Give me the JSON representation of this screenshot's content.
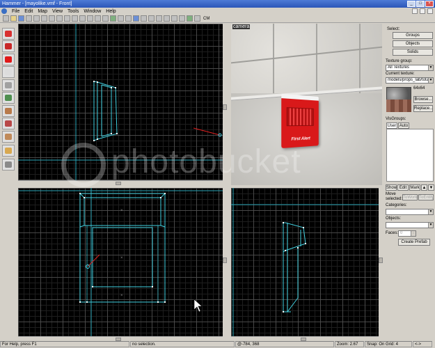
{
  "window": {
    "title": "Hammer - [mayolike.vmf - Front]",
    "controls": [
      "_",
      "□",
      "×"
    ]
  },
  "menu": {
    "items": [
      "File",
      "Edit",
      "Map",
      "View",
      "Tools",
      "Window",
      "Help"
    ]
  },
  "toolbar": {
    "cm_label": "CM"
  },
  "camera": {
    "label": "camera",
    "alarm_text": "First Alert"
  },
  "panel": {
    "select_label": "Select:",
    "groups_button": "Groups",
    "objects_button": "Objects",
    "solids_button": "Solids",
    "texture_group_label": "Texture group:",
    "texture_group_value": "All Textures",
    "current_texture_label": "Current texture:",
    "current_texture_value": "models/props_lab/total",
    "texture_size": "64x64",
    "browse_button": "Browse...",
    "replace_button": "Replace...",
    "visgroups_label": "VisGroups:",
    "tab_user": "User",
    "tab_auto": "Auto",
    "show_button": "Show",
    "edit_button": "Edit",
    "mark_button": "Mark",
    "move_selected_label": "Move selected:",
    "to_world_button": "ToWorld",
    "to_entity_button": "ToEntity",
    "categories_label": "Categories:",
    "objects_label": "Objects:",
    "faces_label": "Faces:",
    "faces_value": "0",
    "create_prefab_button": "Create Prefab"
  },
  "status": {
    "help": "For Help, press F1",
    "selection": "no selection.",
    "coords": "@-784, 368",
    "zoom": "Zoom: 2.67",
    "snap": "Snap: On Grid: 4",
    "mode": "<->"
  },
  "watermark": {
    "text": "photobucket"
  },
  "colors": {
    "viewport_bg": "#000000",
    "brush_line": "#40d0e0",
    "axis_line": "#2aa6b8",
    "selection_red": "#e02020"
  }
}
